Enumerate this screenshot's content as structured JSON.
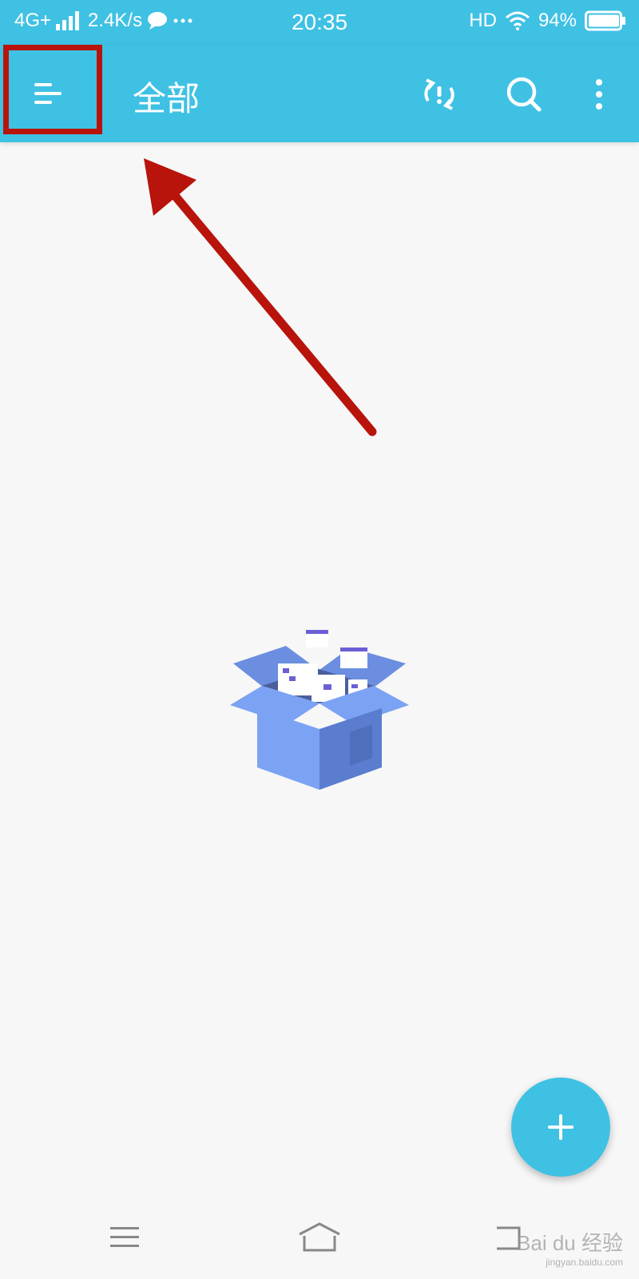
{
  "status_bar": {
    "network": "4G+",
    "speed": "2.4K/s",
    "time": "20:35",
    "hd": "HD",
    "battery": "94%",
    "icons": [
      "signal-icon",
      "chat-bubble-icon",
      "more-dots-icon",
      "wifi-icon",
      "battery-icon"
    ]
  },
  "app_bar": {
    "title": "全部",
    "menu_icon": "menu-lines-icon",
    "actions": [
      "sync-alert-icon",
      "search-icon",
      "more-vertical-icon"
    ],
    "background": "#3fc1e4"
  },
  "annotation": {
    "box_color": "#b8140c",
    "arrow_color": "#b8140c"
  },
  "empty_state": {
    "illustration": "open-box-illustration"
  },
  "fab": {
    "label": "+"
  },
  "nav_bar": {
    "icons": [
      "recent-apps-icon",
      "home-icon",
      "back-icon"
    ]
  },
  "watermark": {
    "text": "Bai du 经验",
    "url": "jingyan.baidu.com"
  }
}
